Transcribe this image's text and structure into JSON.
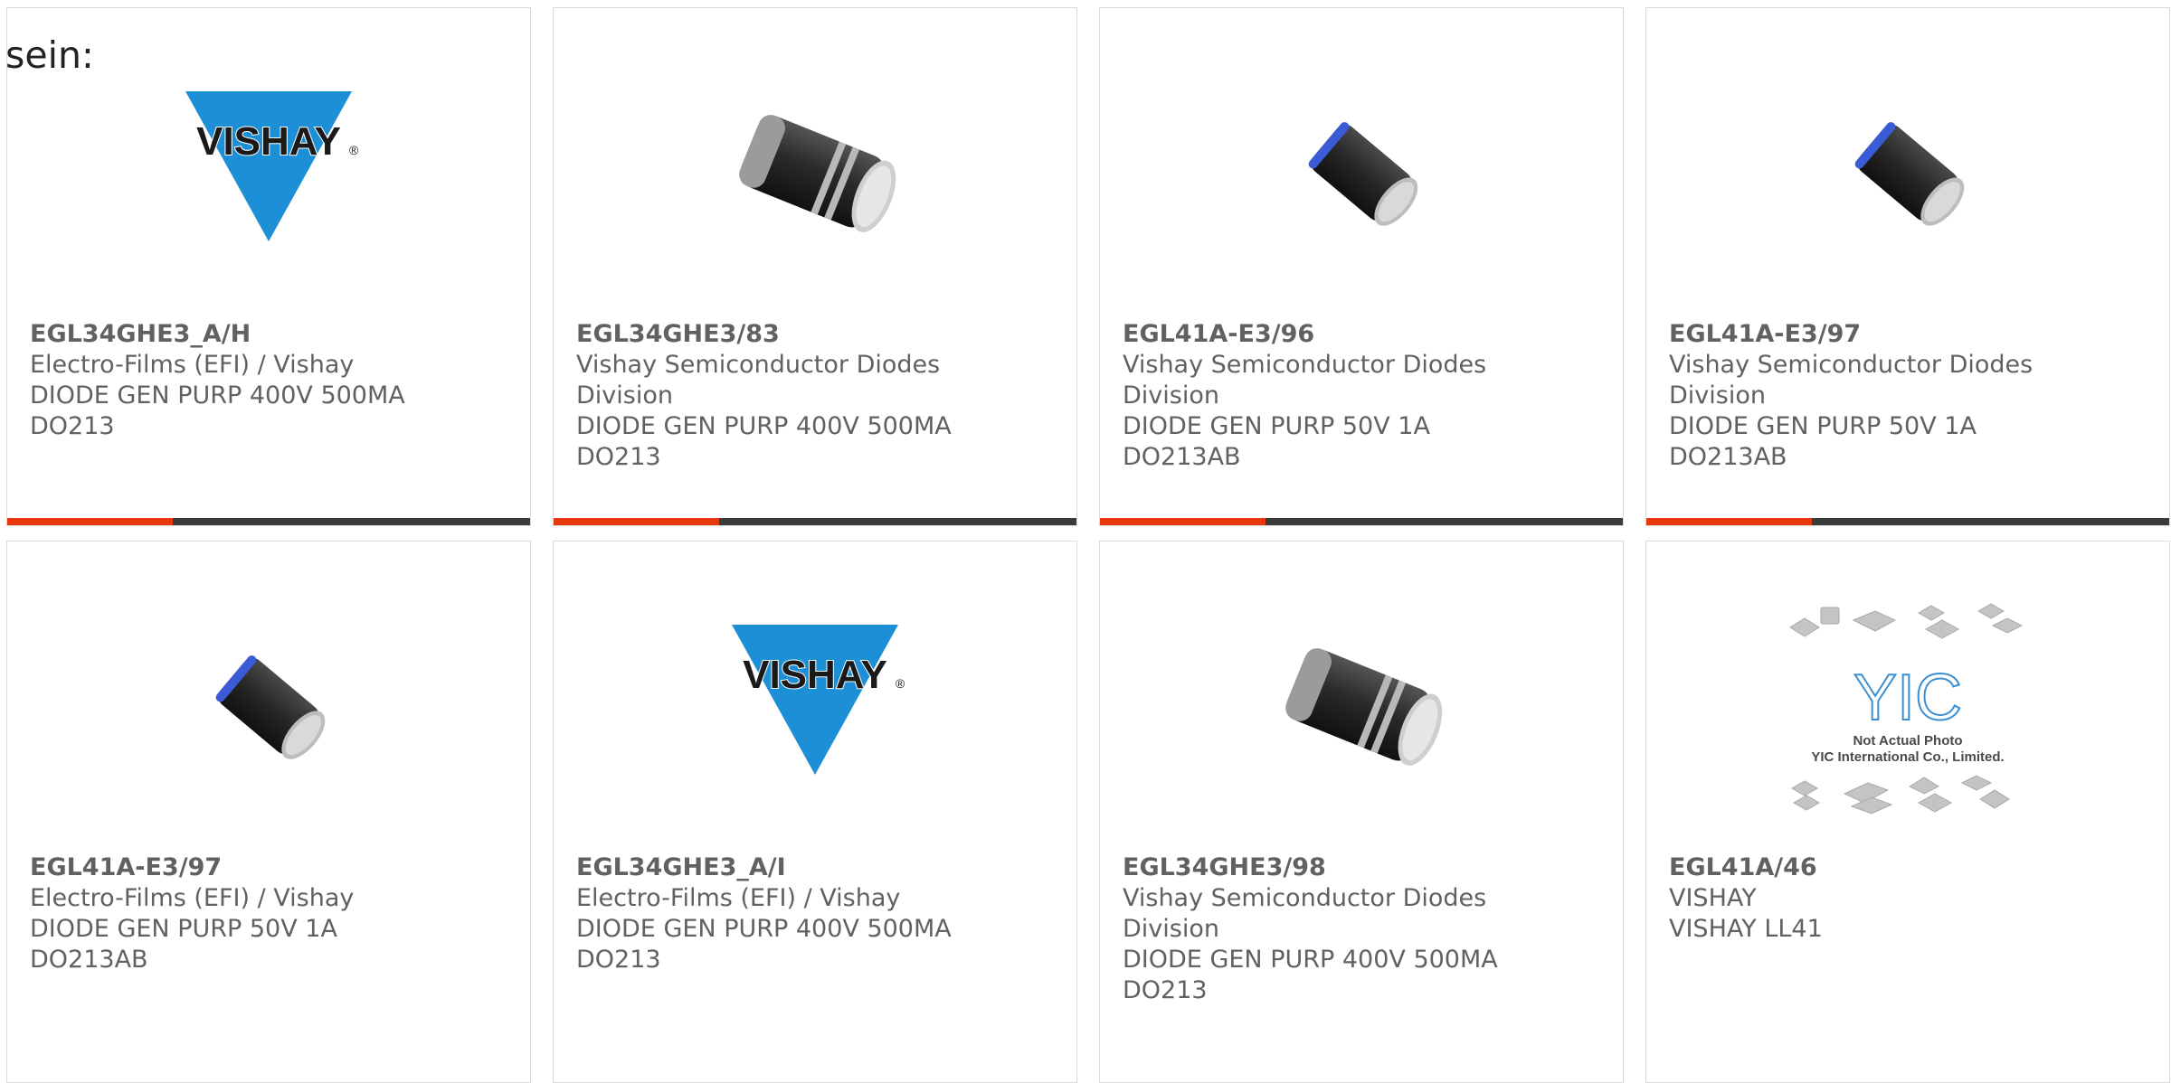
{
  "intro_text": "sein:",
  "colors": {
    "accent": "#e8380d",
    "bar": "#3a3a3a",
    "vishay_blue": "#1d8fd6",
    "text": "#616161"
  },
  "cards": [
    {
      "part_number": "EGL34GHE3_A/H",
      "manufacturer": "Electro-Films (EFI) / Vishay",
      "description": "DIODE GEN PURP 400V 500MA",
      "package": "DO213",
      "image": "vishay-logo"
    },
    {
      "part_number": "EGL34GHE3/83",
      "manufacturer": "Vishay Semiconductor Diodes",
      "manufacturer_line2": "Division",
      "description": "DIODE GEN PURP 400V 500MA",
      "package": "DO213",
      "image": "diode-large-striped"
    },
    {
      "part_number": "EGL41A-E3/96",
      "manufacturer": "Vishay Semiconductor Diodes",
      "manufacturer_line2": "Division",
      "description": "DIODE GEN PURP 50V 1A",
      "package": "DO213AB",
      "image": "diode-small-blue-band"
    },
    {
      "part_number": "EGL41A-E3/97",
      "manufacturer": "Vishay Semiconductor Diodes",
      "manufacturer_line2": "Division",
      "description": "DIODE GEN PURP 50V 1A",
      "package": "DO213AB",
      "image": "diode-small-blue-band"
    },
    {
      "part_number": "EGL41A-E3/97",
      "manufacturer": "Electro-Films (EFI) / Vishay",
      "description": "DIODE GEN PURP 50V 1A",
      "package": "DO213AB",
      "image": "diode-small-blue-band"
    },
    {
      "part_number": "EGL34GHE3_A/I",
      "manufacturer": "Electro-Films (EFI) / Vishay",
      "description": "DIODE GEN PURP 400V 500MA",
      "package": "DO213",
      "image": "vishay-logo"
    },
    {
      "part_number": "EGL34GHE3/98",
      "manufacturer": "Vishay Semiconductor Diodes",
      "manufacturer_line2": "Division",
      "description": "DIODE GEN PURP 400V 500MA",
      "package": "DO213",
      "image": "diode-large-striped"
    },
    {
      "part_number": "EGL41A/46",
      "manufacturer": "VISHAY",
      "description": "VISHAY LL41",
      "image": "yic-placeholder"
    }
  ],
  "images": {
    "vishay_logo_text": "VISHAY",
    "registered_mark": "®",
    "yic_logo_text": "YIC",
    "yic_caption_1": "Not Actual Photo",
    "yic_caption_2": "YIC International Co., Limited."
  }
}
